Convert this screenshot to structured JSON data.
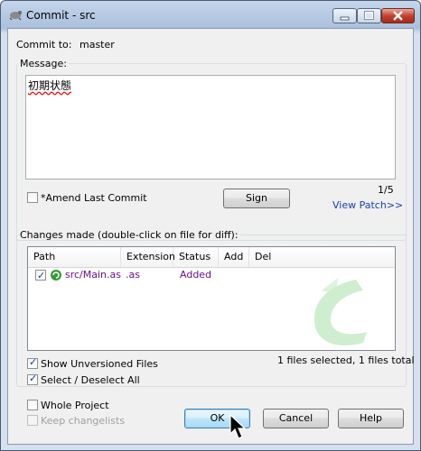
{
  "window": {
    "title": "Commit - src"
  },
  "commit_to": {
    "label": "Commit to:",
    "value": "master"
  },
  "message": {
    "group_label": "Message:",
    "text": "初期状態",
    "counter": "1/5",
    "view_patch": "View Patch>>"
  },
  "amend": {
    "label": "*Amend Last Commit",
    "checked": false
  },
  "sign_button": "Sign",
  "changes": {
    "group_label": "Changes made (double-click on file for diff):",
    "columns": [
      "Path",
      "Extension",
      "Status",
      "Add",
      "Del"
    ],
    "rows": [
      {
        "path": "src/Main.as",
        "extension": ".as",
        "status": "Added",
        "add": "",
        "del": "",
        "checked": true
      }
    ],
    "summary": "1 files selected, 1 files total"
  },
  "options": {
    "show_unversioned": {
      "label": "Show Unversioned Files",
      "checked": true
    },
    "select_all": {
      "label": "Select / Deselect All",
      "checked": true
    },
    "whole_project": {
      "label": "Whole Project",
      "checked": false
    },
    "keep_changelists": {
      "label": "Keep changelists",
      "checked": false,
      "disabled": true
    }
  },
  "buttons": {
    "ok": "OK",
    "cancel": "Cancel",
    "help": "Help"
  },
  "colors": {
    "link": "#1a3fb2",
    "status_added": "#6a0f8a",
    "watermark": "#7fcf7f"
  }
}
